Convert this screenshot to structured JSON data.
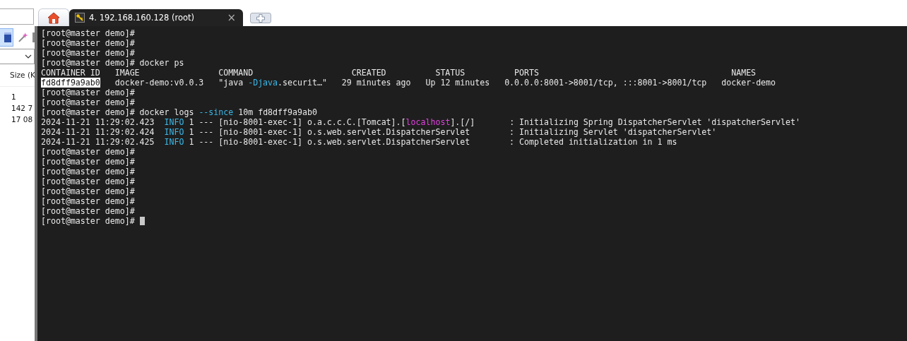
{
  "tabs": [
    {
      "kind": "home",
      "selected": false
    },
    {
      "kind": "session",
      "label": "4. 192.168.160.128 (root)",
      "close": "×",
      "selected": true
    }
  ],
  "side_panel": {
    "column_header": "Size (K",
    "values": [
      "1",
      "142 7",
      "17 08"
    ]
  },
  "terminal": {
    "lines": [
      [
        {
          "text": "[root@master demo]#"
        }
      ],
      [
        {
          "text": "[root@master demo]#"
        }
      ],
      [
        {
          "text": "[root@master demo]#"
        }
      ],
      [
        {
          "text": "[root@master demo]# docker ps"
        }
      ],
      [
        {
          "text": "CONTAINER ID   IMAGE                COMMAND                    CREATED          STATUS          PORTS                                       NAMES"
        }
      ],
      [
        {
          "text": "fd8dff9a9ab0",
          "kind": "highlight"
        },
        {
          "text": "   docker-demo:v0.0.3   \"java "
        },
        {
          "text": "-Djava",
          "kind": "cyan"
        },
        {
          "text": ".securit…\"   29 minutes ago   Up 12 minutes   0.0.0.0:8001->8001/tcp, :::8001->8001/tcp   docker-demo"
        }
      ],
      [
        {
          "text": "[root@master demo]#"
        }
      ],
      [
        {
          "text": "[root@master demo]#"
        }
      ],
      [
        {
          "text": "[root@master demo]# docker logs "
        },
        {
          "text": "--since",
          "kind": "cyan"
        },
        {
          "text": " 10m fd8dff9a9ab0"
        }
      ],
      [
        {
          "text": "2024-11-21 11:29:02.423  "
        },
        {
          "text": "INFO",
          "kind": "cyan"
        },
        {
          "text": " 1 --- [nio-8001-exec-1] o.a.c.c.C.[Tomcat].["
        },
        {
          "text": "localhost",
          "kind": "magenta"
        },
        {
          "text": "].[/]       : Initializing Spring DispatcherServlet 'dispatcherServlet'"
        }
      ],
      [
        {
          "text": "2024-11-21 11:29:02.424  "
        },
        {
          "text": "INFO",
          "kind": "cyan"
        },
        {
          "text": " 1 --- [nio-8001-exec-1] o.s.web.servlet.DispatcherServlet        : Initializing Servlet 'dispatcherServlet'"
        }
      ],
      [
        {
          "text": "2024-11-21 11:29:02.425  "
        },
        {
          "text": "INFO",
          "kind": "cyan"
        },
        {
          "text": " 1 --- [nio-8001-exec-1] o.s.web.servlet.DispatcherServlet        : Completed initialization in 1 ms"
        }
      ],
      [
        {
          "text": "[root@master demo]#"
        }
      ],
      [
        {
          "text": "[root@master demo]#"
        }
      ],
      [
        {
          "text": "[root@master demo]#"
        }
      ],
      [
        {
          "text": "[root@master demo]#"
        }
      ],
      [
        {
          "text": "[root@master demo]#"
        }
      ],
      [
        {
          "text": "[root@master demo]#"
        }
      ],
      [
        {
          "text": "[root@master demo]#"
        }
      ],
      [
        {
          "text": "[root@master demo]# "
        }
      ]
    ]
  }
}
